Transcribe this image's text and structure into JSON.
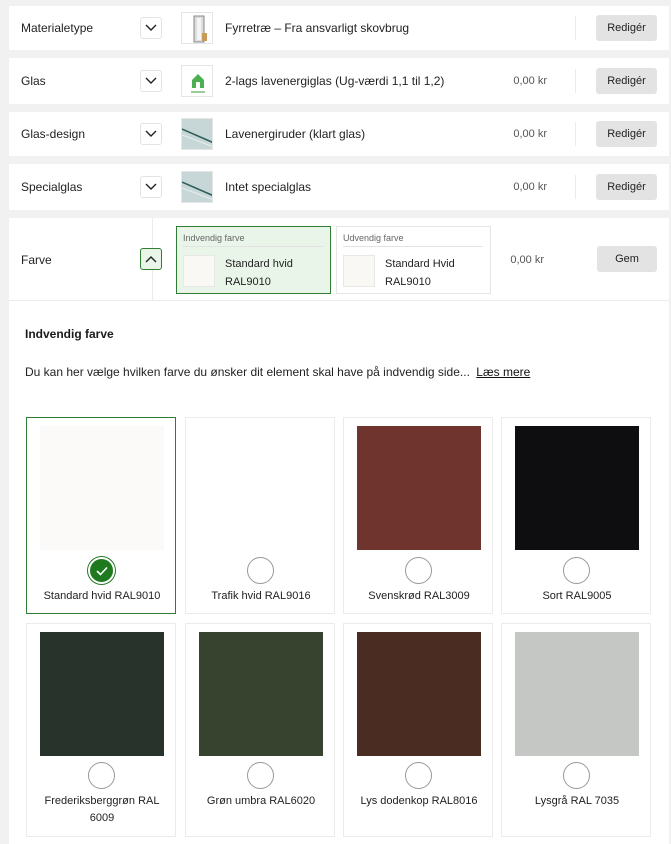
{
  "rows": [
    {
      "label": "Materialetype",
      "option": "Fyrretræ – Fra ansvarligt skovbrug",
      "price": "",
      "button": "Redigér",
      "icon": "window-frame-icon"
    },
    {
      "label": "Glas",
      "option": "2-lags lavenergiglas (Ug-værdi 1,1 til 1,2)",
      "price": "0,00 kr",
      "button": "Redigér",
      "icon": "energy-label-icon"
    },
    {
      "label": "Glas-design",
      "option": "Lavenergiruder (klart glas)",
      "price": "0,00 kr",
      "button": "Redigér",
      "icon": "glass-pane-icon"
    },
    {
      "label": "Specialglas",
      "option": "Intet specialglas",
      "price": "0,00 kr",
      "button": "Redigér",
      "icon": "glass-pane-icon"
    }
  ],
  "farve": {
    "label": "Farve",
    "price": "0,00 kr",
    "button": "Gem",
    "inner": {
      "caption": "Indvendig farve",
      "name": "Standard hvid RAL9010"
    },
    "outer": {
      "caption": "Udvendig farve",
      "name": "Standard Hvid RAL9010"
    }
  },
  "panel": {
    "title": "Indvendig farve",
    "description": "Du kan her vælge hvilken farve du ønsker dit element skal have på indvendig side...",
    "more_link": "Læs mere"
  },
  "colors": [
    {
      "name": "Standard hvid RAL9010",
      "hex": "#fbfaf8",
      "selected": true
    },
    {
      "name": "Trafik hvid RAL9016",
      "hex": "#ffffff",
      "selected": false
    },
    {
      "name": "Svenskrød RAL3009",
      "hex": "#6f342e",
      "selected": false
    },
    {
      "name": "Sort RAL9005",
      "hex": "#0e0e10",
      "selected": false
    },
    {
      "name": "Frederiksberggrøn RAL 6009",
      "hex": "#28342b",
      "selected": false
    },
    {
      "name": "Grøn umbra RAL6020",
      "hex": "#38432f",
      "selected": false
    },
    {
      "name": "Lys dodenkop RAL8016",
      "hex": "#4a2c23",
      "selected": false
    },
    {
      "name": "Lysgrå RAL 7035",
      "hex": "#c5c7c4",
      "selected": false
    }
  ],
  "accent": "#2e7d32"
}
